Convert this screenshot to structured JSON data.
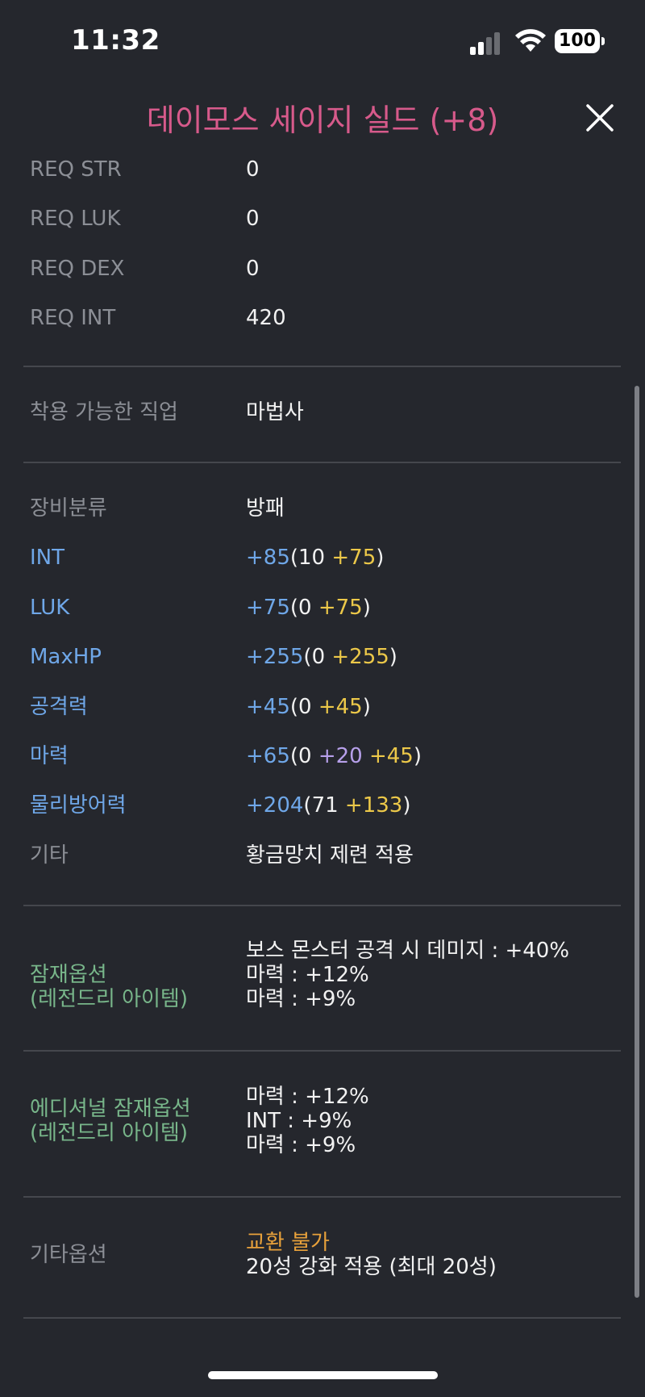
{
  "status": {
    "time": "11:32",
    "battery": "100"
  },
  "header": {
    "title": "데이모스 세이지 실드 (+8)"
  },
  "requirements": [
    {
      "label": "REQ STR",
      "value": "0"
    },
    {
      "label": "REQ LUK",
      "value": "0"
    },
    {
      "label": "REQ DEX",
      "value": "0"
    },
    {
      "label": "REQ INT",
      "value": "420"
    }
  ],
  "job": {
    "label": "착용 가능한 직업",
    "value": "마법사"
  },
  "equip": {
    "category_label": "장비분류",
    "category_value": "방패",
    "stats": [
      {
        "label": "INT",
        "total": "+85",
        "open": "(10 ",
        "bonus1": "",
        "bonus2": "+75",
        "close": ")"
      },
      {
        "label": "LUK",
        "total": "+75",
        "open": "(0 ",
        "bonus1": "",
        "bonus2": "+75",
        "close": ")"
      },
      {
        "label": "MaxHP",
        "total": "+255",
        "open": "(0 ",
        "bonus1": "",
        "bonus2": "+255",
        "close": ")"
      },
      {
        "label": "공격력",
        "total": "+45",
        "open": "(0 ",
        "bonus1": "",
        "bonus2": "+45",
        "close": ")"
      },
      {
        "label": "마력",
        "total": "+65",
        "open": "(0 ",
        "bonus1": "+20 ",
        "bonus2": "+45",
        "close": ")"
      },
      {
        "label": "물리방어력",
        "total": "+204",
        "open": "(71 ",
        "bonus1": "",
        "bonus2": "+133",
        "close": ")"
      }
    ],
    "etc_label": "기타",
    "etc_value": "황금망치 제련 적용"
  },
  "potential": {
    "label_line1": "잠재옵션",
    "label_line2": "(레전드리 아이템)",
    "lines": [
      "보스 몬스터 공격 시 데미지 : +40%",
      "마력 : +12%",
      "마력 : +9%"
    ]
  },
  "additional": {
    "label_line1": "에디셔널 잠재옵션",
    "label_line2": "(레전드리 아이템)",
    "lines": [
      "마력 : +12%",
      "INT : +9%",
      "마력 : +9%"
    ]
  },
  "etc_options": {
    "label": "기타옵션",
    "trade": "교환 불가",
    "starforce": "20성 강화 적용 (최대 20성)"
  },
  "colors": {
    "title": "#d75a8b",
    "stat_label": "#6fa7e8",
    "bonus": "#ecc849",
    "starforce": "#b7a0ea",
    "potential_label": "#78b68a",
    "untradeable": "#e8a13b"
  }
}
